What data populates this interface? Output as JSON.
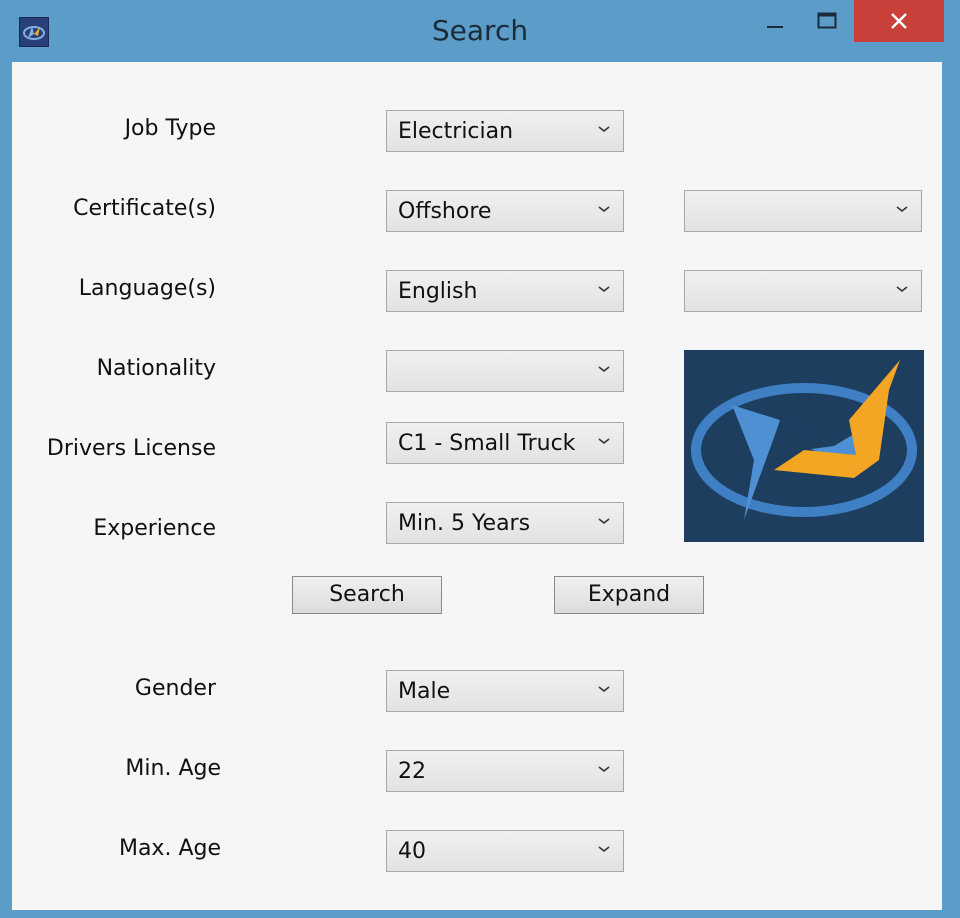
{
  "window": {
    "title": "Search"
  },
  "form": {
    "job_type": {
      "label": "Job Type",
      "value": "Electrician"
    },
    "certificates": {
      "label": "Certificate(s)",
      "value": "Offshore",
      "value2": ""
    },
    "languages": {
      "label": "Language(s)",
      "value": "English",
      "value2": ""
    },
    "nationality": {
      "label": "Nationality",
      "value": ""
    },
    "drivers_license": {
      "label": "Drivers License",
      "value": "C1 - Small Truck"
    },
    "experience": {
      "label": "Experience",
      "value": "Min. 5 Years"
    },
    "gender": {
      "label": "Gender",
      "value": "Male"
    },
    "min_age": {
      "label": "Min. Age",
      "value": "22"
    },
    "max_age": {
      "label": "Max. Age",
      "value": "40"
    }
  },
  "buttons": {
    "search": "Search",
    "expand": "Expand"
  },
  "colors": {
    "title_bar": "#5b9dc8",
    "close_button": "#c9403a",
    "client_background": "#f6f6f6",
    "logo_background": "#1d3e5f",
    "logo_blue": "#3f7fc4",
    "logo_orange": "#f2a623"
  },
  "icons": {
    "app": "app-logo-icon",
    "minimize": "minimize-icon",
    "maximize": "maximize-icon",
    "close": "close-icon",
    "dropdown": "chevron-down-icon"
  }
}
